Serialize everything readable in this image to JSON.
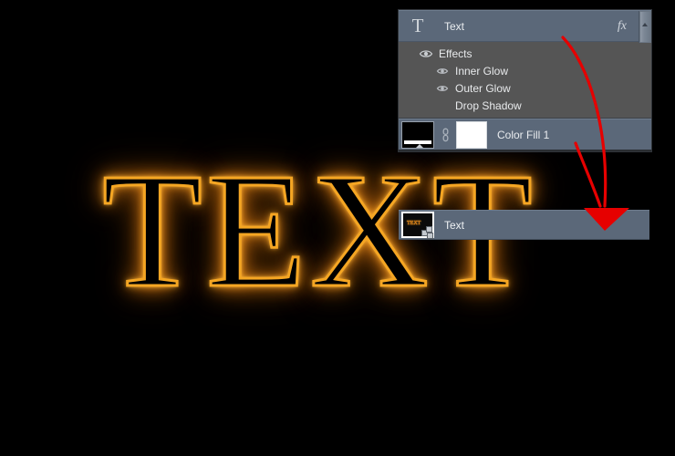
{
  "canvas": {
    "background_color": "#000000",
    "artwork_text": "TEXT",
    "glow_color": "#f5a623",
    "glow_highlight": "#ffc04d"
  },
  "layers_panel": {
    "accent_selected_color": "#5b6879",
    "effects_background_color": "#555555",
    "header": {
      "type_icon": "type-T-icon",
      "title": "Text",
      "fx_badge": "fx",
      "scrollbar": {
        "up_arrow": "scroll-up-arrow"
      }
    },
    "effects": {
      "group_label": "Effects",
      "items": [
        {
          "label": "Inner Glow",
          "visible": true
        },
        {
          "label": "Outer Glow",
          "visible": true
        },
        {
          "label": "Drop Shadow",
          "visible": false
        }
      ]
    },
    "fill_layer": {
      "label": "Color Fill 1",
      "thumbnail": "gradient-thumbnail",
      "link_icon": "link-icon",
      "mask_thumbnail": "layer-mask-thumbnail"
    }
  },
  "text_layer_row": {
    "label": "Text",
    "thumbnail": "text-layer-thumbnail",
    "badge": "smart-object-badge",
    "mini_preview_text": "TEXT"
  },
  "annotation": {
    "arrow_color": "#e60000",
    "name": "red-curved-arrow"
  }
}
